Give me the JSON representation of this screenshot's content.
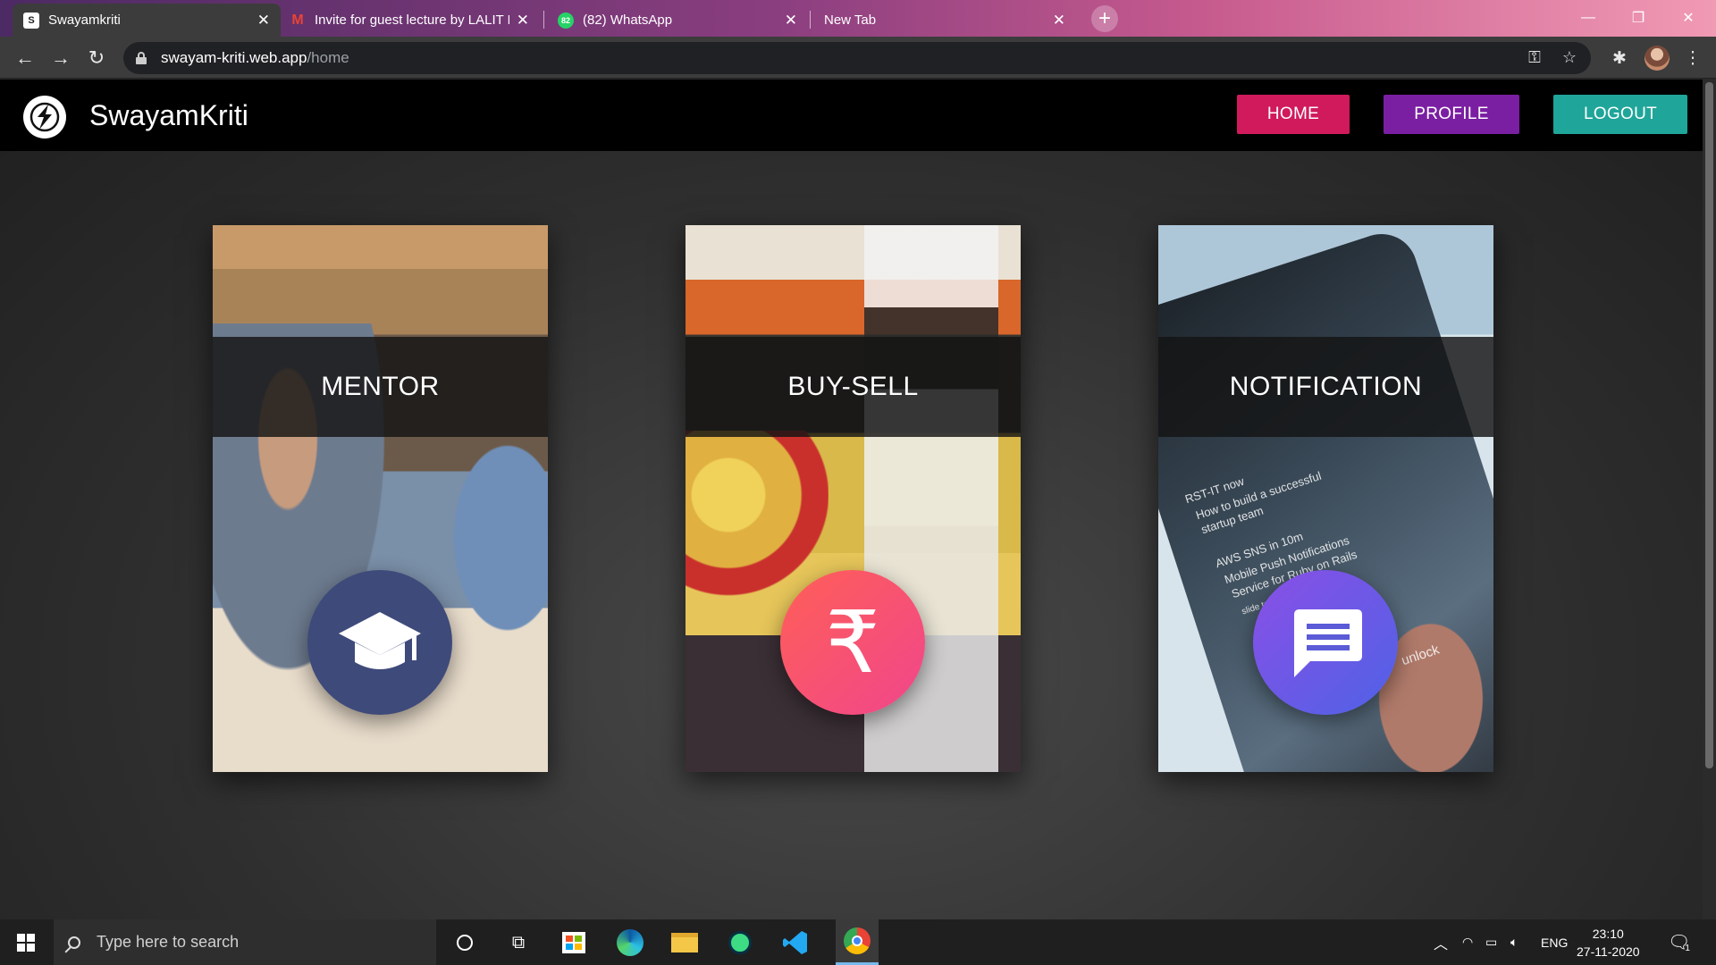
{
  "browser": {
    "tabs": [
      {
        "title": "Swayamkriti",
        "favicon": "swayamkriti-logo-icon",
        "active": true
      },
      {
        "title": "Invite for guest lecture by LALIT K",
        "favicon": "gmail-icon",
        "active": false
      },
      {
        "title": "(82) WhatsApp",
        "favicon": "whatsapp-icon",
        "active": false
      },
      {
        "title": "New Tab",
        "favicon": "",
        "active": false
      }
    ],
    "url_host": "swayam-kriti.web.app",
    "url_path": "/home"
  },
  "site": {
    "brand": "SwayamKriti",
    "nav": {
      "home": "HOME",
      "profile": "PROFILE",
      "logout": "LOGOUT"
    },
    "colors": {
      "home": "#d01a5c",
      "profile": "#7a1fa2",
      "logout": "#1fa59a"
    },
    "cards": [
      {
        "title": "MENTOR",
        "icon": "graduation-cap-icon",
        "circle_color": "#3e4a7a"
      },
      {
        "title": "BUY-SELL",
        "icon": "rupee-icon",
        "circle_color": "#f0506e"
      },
      {
        "title": "NOTIFICATION",
        "icon": "chat-message-icon",
        "circle_color": "#6d4de0"
      }
    ],
    "notification_photo_text": {
      "line1": "RST-IT now",
      "line2": "How to build a successful",
      "line3": "startup team",
      "line4": "AWS SNS in 10m",
      "line5": "Mobile Push Notifications",
      "line6": "Service for Ruby on Rails",
      "line7": "slide to view",
      "line8": "unlock"
    }
  },
  "taskbar": {
    "search_placeholder": "Type here to search",
    "language": "ENG",
    "time": "23:10",
    "date": "27-11-2020",
    "notification_count": "1"
  }
}
